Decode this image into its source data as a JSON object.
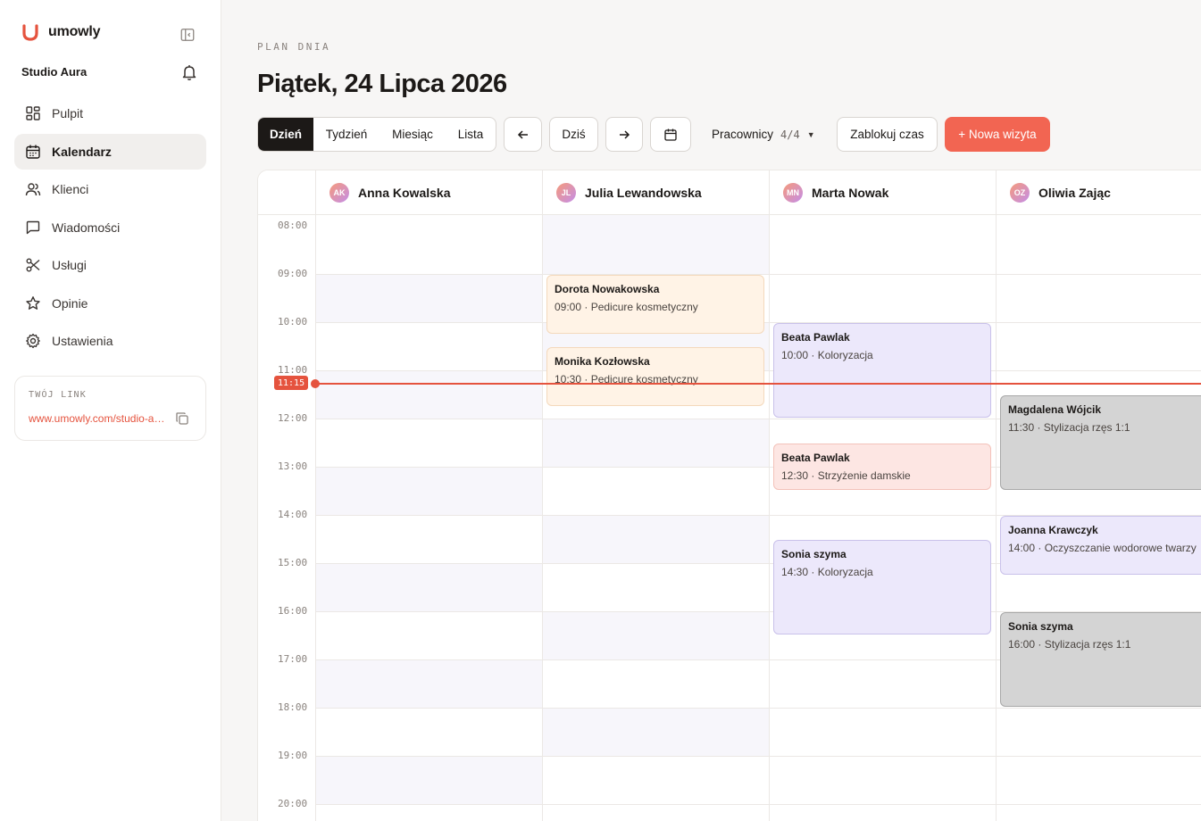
{
  "brand": {
    "name": "umowly"
  },
  "studio": {
    "name": "Studio Aura"
  },
  "nav": [
    {
      "label": "Pulpit",
      "icon": "grid-icon"
    },
    {
      "label": "Kalendarz",
      "icon": "calendar-icon",
      "active": true
    },
    {
      "label": "Klienci",
      "icon": "users-icon"
    },
    {
      "label": "Wiadomości",
      "icon": "message-icon"
    },
    {
      "label": "Usługi",
      "icon": "scissors-icon"
    },
    {
      "label": "Opinie",
      "icon": "star-icon"
    },
    {
      "label": "Ustawienia",
      "icon": "gear-icon"
    }
  ],
  "link_card": {
    "label": "TWÓJ LINK",
    "url": "www.umowly.com/studio-aura"
  },
  "header": {
    "eyebrow": "PLAN DNIA",
    "title": "Piątek, 24 Lipca 2026"
  },
  "toolbar": {
    "views": [
      "Dzień",
      "Tydzień",
      "Miesiąc",
      "Lista"
    ],
    "active_view": "Dzień",
    "today_label": "Dziś",
    "staff_label": "Pracownicy",
    "staff_count": "4/4",
    "block_label": "Zablokuj czas",
    "new_label": "+ Nowa wizyta"
  },
  "calendar": {
    "hours": [
      "08:00",
      "09:00",
      "10:00",
      "11:00",
      "12:00",
      "13:00",
      "14:00",
      "15:00",
      "16:00",
      "17:00",
      "18:00",
      "19:00",
      "20:00"
    ],
    "now_label": "11:15",
    "staff": [
      {
        "initials": "AK",
        "name": "Anna Kowalska"
      },
      {
        "initials": "JL",
        "name": "Julia Lewandowska"
      },
      {
        "initials": "MN",
        "name": "Marta Nowak"
      },
      {
        "initials": "OZ",
        "name": "Oliwia Zając"
      }
    ],
    "appointments": [
      {
        "staff": 1,
        "client": "Dorota Nowakowska",
        "time": "09:00",
        "service": "Pedicure kosmetyczny",
        "start": 9.0,
        "end": 10.25,
        "tone": "peach"
      },
      {
        "staff": 1,
        "client": "Monika Kozłowska",
        "time": "10:30",
        "service": "Pedicure kosmetyczny",
        "start": 10.5,
        "end": 11.75,
        "tone": "peach"
      },
      {
        "staff": 2,
        "client": "Beata Pawlak",
        "time": "10:00",
        "service": "Koloryzacja",
        "start": 10.0,
        "end": 12.0,
        "tone": "lavender"
      },
      {
        "staff": 2,
        "client": "Beata Pawlak",
        "time": "12:30",
        "service": "Strzyżenie damskie",
        "start": 12.5,
        "end": 13.5,
        "tone": "pink"
      },
      {
        "staff": 2,
        "client": "Sonia szyma",
        "time": "14:30",
        "service": "Koloryzacja",
        "start": 14.5,
        "end": 16.5,
        "tone": "lavender"
      },
      {
        "staff": 3,
        "client": "Magdalena Wójcik",
        "time": "11:30",
        "service": "Stylizacja rzęs 1:1",
        "start": 11.5,
        "end": 13.5,
        "tone": "gray"
      },
      {
        "staff": 3,
        "client": "Joanna Krawczyk",
        "time": "14:00",
        "service": "Oczyszczanie wodorowe twarzy",
        "start": 14.0,
        "end": 15.25,
        "tone": "lavender"
      },
      {
        "staff": 3,
        "client": "Sonia szyma",
        "time": "16:00",
        "service": "Stylizacja rzęs 1:1",
        "start": 16.0,
        "end": 18.0,
        "tone": "gray"
      }
    ]
  }
}
